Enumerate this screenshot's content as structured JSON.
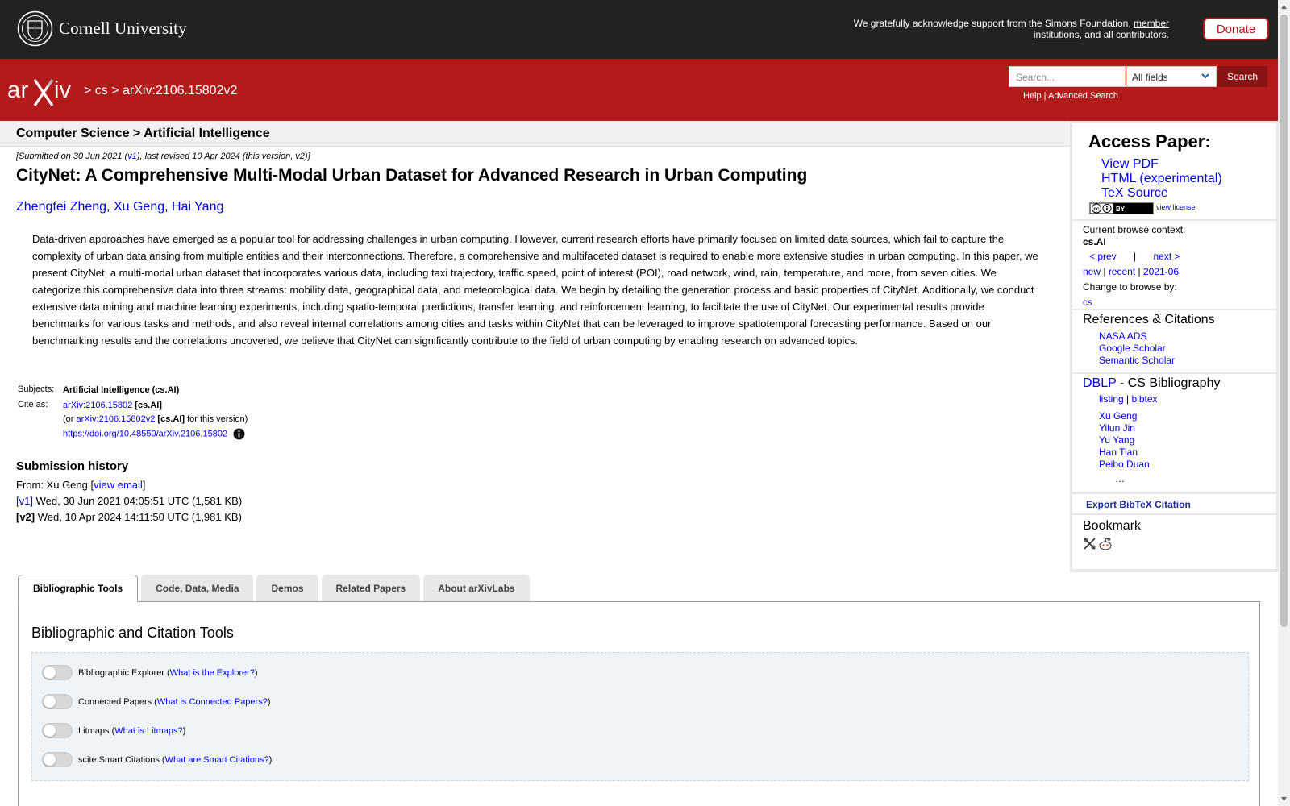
{
  "cornell": {
    "name": "Cornell University",
    "ack_text": "We gratefully acknowledge support from the Simons Foundation, ",
    "ack_link": "member institutions",
    "ack_tail": ", and all contributors.",
    "donate_label": "Donate"
  },
  "header": {
    "logo_text": "arXiv",
    "crumb_cs": "cs",
    "crumb_id": "arXiv:2106.15802v2",
    "search_placeholder": "Search...",
    "search_field": "All fields",
    "search_button": "Search",
    "help_link": "Help",
    "advanced_link": "Advanced Search"
  },
  "paper": {
    "subject_bar": "Computer Science > Artificial Intelligence",
    "dateline_pre": "[Submitted on 30 Jun 2021 (",
    "dateline_v1": "v1",
    "dateline_post": "), last revised 10 Apr 2024 (this version, v2)]",
    "title": "CityNet: A Comprehensive Multi-Modal Urban Dataset for Advanced Research in Urban Computing",
    "authors": [
      "Zhengfei Zheng",
      "Xu Geng",
      "Hai Yang"
    ],
    "abstract": "Data-driven approaches have emerged as a popular tool for addressing challenges in urban computing. However, current research efforts have primarily focused on limited data sources, which fail to capture the complexity of urban data arising from multiple entities and their interconnections. Therefore, a comprehensive and multifaceted dataset is required to enable more extensive studies in urban computing. In this paper, we present CityNet, a multi-modal urban dataset that incorporates various data, including taxi trajectory, traffic speed, point of interest (POI), road network, wind, rain, temperature, and more, from seven cities. We categorize this comprehensive data into three streams: mobility data, geographical data, and meteorological data. We begin by detailing the generation process and basic properties of CityNet. Additionally, we conduct extensive data mining and machine learning experiments, including spatio-temporal predictions, transfer learning, and reinforcement learning, to facilitate the use of CityNet. Our experimental results provide benchmarks for various tasks and methods, and also reveal internal correlations among cities and tasks within CityNet that can be leveraged to improve spatiotemporal forecasting performance. Based on our benchmarking results and the correlations uncovered, we believe that CityNet can significantly contribute to the field of urban computing by enabling research on advanced topics.",
    "subjects_label": "Subjects:",
    "subjects_value": "Artificial Intelligence (cs.AI)",
    "cite_label": "Cite as:",
    "cite_id": "arXiv:2106.15802",
    "cite_cat": "[cs.AI]",
    "cite_or": "(or ",
    "cite_v2": "arXiv:2106.15802v2",
    "cite_v2_cat": "[cs.AI]",
    "cite_v2_tail": " for this version)",
    "doi": "https://doi.org/10.48550/arXiv.2106.15802",
    "history_title": "Submission history",
    "history_from": "From: Xu Geng [",
    "history_email": "view email",
    "history_from_close": "]",
    "v1_label": "[v1]",
    "v1_text": " Wed, 30 Jun 2021 04:05:51 UTC (1,581 KB)",
    "v2_label": "[v2]",
    "v2_text": " Wed, 10 Apr 2024 14:11:50 UTC (1,981 KB)"
  },
  "sidebar": {
    "access_title": "Access Paper:",
    "view_pdf": "View PDF",
    "html": "HTML (experimental)",
    "tex": "TeX Source",
    "view_license": "view license",
    "browse_context_label": "Current browse context:",
    "browse_context": "cs.AI",
    "prev": "< prev",
    "sep": "|",
    "next": "next >",
    "new": "new",
    "recent": "recent",
    "month": "2021-06",
    "change_browse": "Change to browse by:",
    "browse_cs": "cs",
    "refs_title": "References & Citations",
    "refs": [
      "NASA ADS",
      "Google Scholar",
      "Semantic Scholar"
    ],
    "dblp": "DBLP",
    "dblp_tail": " - CS Bibliography",
    "listing": "listing",
    "bibtex": "bibtex",
    "dblp_authors": [
      "Xu Geng",
      "Yilun Jin",
      "Yu Yang",
      "Han Tian",
      "Peibo Duan"
    ],
    "ellipsis": "…",
    "export_bibtex": "Export BibTeX Citation",
    "bookmark": "Bookmark"
  },
  "tabs": {
    "items": [
      "Bibliographic Tools",
      "Code, Data, Media",
      "Demos",
      "Related Papers",
      "About arXivLabs"
    ],
    "panel_title": "Bibliographic and Citation Tools",
    "tools": [
      {
        "name": "Bibliographic Explorer",
        "help": "What is the Explorer?"
      },
      {
        "name": "Connected Papers",
        "help": "What is Connected Papers?"
      },
      {
        "name": "Litmaps",
        "help": "What is Litmaps?"
      },
      {
        "name": "scite Smart Citations",
        "help": "What are Smart Citations?"
      }
    ]
  },
  "colors": {
    "brand_red": "#b31b1b",
    "dark_bar": "#222222",
    "link": "#0000ee"
  }
}
